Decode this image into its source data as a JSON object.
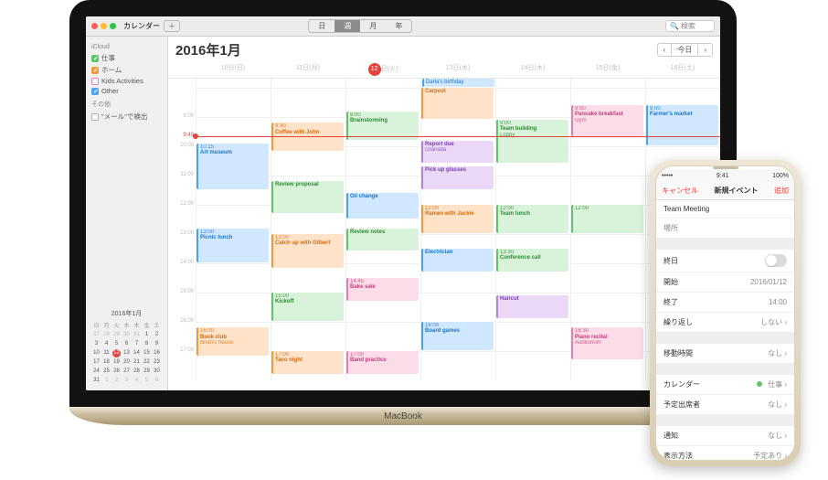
{
  "mac": {
    "titlebar": {
      "app_label": "カレンダー",
      "views": {
        "day": "日",
        "week": "週",
        "month": "月",
        "year": "年"
      },
      "search_placeholder": "検索"
    },
    "sidebar": {
      "sections": {
        "icloud": "iCloud",
        "other": "その他"
      },
      "calendars": [
        {
          "label": "仕事",
          "color": "#60c46a",
          "checked": true
        },
        {
          "label": "ホーム",
          "color": "#f09b3b",
          "checked": true
        },
        {
          "label": "Kids Activities",
          "color": "#e87db0",
          "checked": false
        },
        {
          "label": "Other",
          "color": "#4aa3ef",
          "checked": true
        }
      ],
      "other": [
        {
          "label": "\"メール\"で検出",
          "checked": false
        }
      ],
      "mini": {
        "title": "2016年1月",
        "dow": [
          "日",
          "月",
          "火",
          "水",
          "木",
          "金",
          "土"
        ],
        "weeks": [
          [
            "27",
            "28",
            "29",
            "30",
            "31",
            "1",
            "2"
          ],
          [
            "3",
            "4",
            "5",
            "6",
            "7",
            "8",
            "9"
          ],
          [
            "10",
            "11",
            "12",
            "13",
            "14",
            "15",
            "16"
          ],
          [
            "17",
            "18",
            "19",
            "20",
            "21",
            "22",
            "23"
          ],
          [
            "24",
            "25",
            "26",
            "27",
            "28",
            "29",
            "30"
          ],
          [
            "31",
            "1",
            "2",
            "3",
            "4",
            "5",
            "6"
          ]
        ],
        "today_row": 2,
        "today_col": 2
      }
    },
    "calendar": {
      "title": "2016年1月",
      "today_btn": "今日",
      "days": [
        {
          "label": "10日(日)"
        },
        {
          "label": "11日(月)"
        },
        {
          "label": "12日(火)",
          "today": true
        },
        {
          "label": "13日(水)"
        },
        {
          "label": "14日(木)"
        },
        {
          "label": "15日(金)"
        },
        {
          "label": "16日(土)"
        }
      ],
      "allday": [
        {
          "day": 3,
          "label": "Darla's birthday",
          "color": "blue"
        }
      ],
      "hours": [
        "9:00",
        "10:00",
        "11:00",
        "12:00",
        "13:00",
        "14:00",
        "15:00",
        "16:00",
        "17:00"
      ],
      "now": {
        "day": 2,
        "frac": 0.09
      },
      "events": [
        {
          "day": 0,
          "start": 9.9,
          "end": 11.5,
          "title": "Art museum",
          "time": "10:15",
          "color": "blue"
        },
        {
          "day": 0,
          "start": 12.8,
          "end": 14,
          "title": "Picnic lunch",
          "time": "13:00",
          "color": "blue"
        },
        {
          "day": 0,
          "start": 16.2,
          "end": 17.2,
          "title": "Book club",
          "sub": "Brian's house",
          "time": "16:00",
          "color": "orange"
        },
        {
          "day": 1,
          "start": 9.2,
          "end": 10.2,
          "title": "Coffee with John",
          "time": "9:30",
          "color": "orange"
        },
        {
          "day": 1,
          "start": 11.2,
          "end": 12.3,
          "title": "Review proposal",
          "color": "green"
        },
        {
          "day": 1,
          "start": 13,
          "end": 14.2,
          "title": "Catch up with Gilbert",
          "time": "13:00",
          "color": "orange"
        },
        {
          "day": 1,
          "start": 15,
          "end": 16,
          "title": "Kickoff",
          "time": "15:00",
          "color": "green"
        },
        {
          "day": 1,
          "start": 17,
          "end": 17.8,
          "title": "Taco night",
          "time": "17:00",
          "color": "orange"
        },
        {
          "day": 2,
          "start": 8.8,
          "end": 9.8,
          "title": "Brainstorming",
          "time": "9:00",
          "color": "green"
        },
        {
          "day": 2,
          "start": 11.6,
          "end": 12.5,
          "title": "Oil change",
          "color": "blue"
        },
        {
          "day": 2,
          "start": 12.8,
          "end": 13.6,
          "title": "Review notes",
          "color": "green"
        },
        {
          "day": 2,
          "start": 14.5,
          "end": 15.3,
          "title": "Bake sale",
          "time": "14:45",
          "color": "pink"
        },
        {
          "day": 2,
          "start": 17,
          "end": 17.8,
          "title": "Band practice",
          "time": "17:00",
          "color": "pink"
        },
        {
          "day": 3,
          "start": 8,
          "end": 9.1,
          "title": "Carpool",
          "color": "orange"
        },
        {
          "day": 3,
          "start": 9.8,
          "end": 10.6,
          "title": "Report due",
          "sub": "Granada",
          "color": "purple"
        },
        {
          "day": 3,
          "start": 10.7,
          "end": 11.5,
          "title": "Pick up glasses",
          "color": "purple"
        },
        {
          "day": 3,
          "start": 12,
          "end": 13,
          "title": "Ramen with Jackie",
          "time": "12:00",
          "color": "orange"
        },
        {
          "day": 3,
          "start": 13.5,
          "end": 14.3,
          "title": "Electrician",
          "color": "blue"
        },
        {
          "day": 3,
          "start": 16,
          "end": 17,
          "title": "Board games",
          "time": "16:00",
          "color": "blue"
        },
        {
          "day": 4,
          "start": 9.1,
          "end": 10.6,
          "title": "Team building",
          "sub": "Lobby",
          "time": "9:00",
          "color": "green"
        },
        {
          "day": 4,
          "start": 12,
          "end": 13,
          "title": "Team lunch",
          "time": "12:00",
          "color": "green"
        },
        {
          "day": 4,
          "start": 13.5,
          "end": 14.3,
          "title": "Conference call",
          "time": "13:30",
          "color": "green"
        },
        {
          "day": 4,
          "start": 15.1,
          "end": 15.9,
          "title": "Haircut",
          "color": "purple"
        },
        {
          "day": 5,
          "start": 8.6,
          "end": 9.7,
          "title": "Pancake breakfast",
          "sub": "Gym",
          "time": "9:00",
          "color": "pink"
        },
        {
          "day": 5,
          "start": 12,
          "end": 13,
          "title": "",
          "time": "12:00",
          "color": "green"
        },
        {
          "day": 5,
          "start": 16.2,
          "end": 17.3,
          "title": "Piano recital",
          "sub": "Auditorium",
          "time": "16:30",
          "color": "pink"
        },
        {
          "day": 6,
          "start": 8.6,
          "end": 10,
          "title": "Farmer's market",
          "time": "9:00",
          "color": "blue"
        }
      ]
    },
    "hinge_label": "MacBook"
  },
  "iphone": {
    "status": {
      "carrier": "•••••",
      "time": "9:41",
      "batt": "100%"
    },
    "nav": {
      "cancel": "キャンセル",
      "title": "新規イベント",
      "add": "追加"
    },
    "event_title": "Team Meeting",
    "location_ph": "場所",
    "rows": {
      "allday_label": "終日",
      "start_label": "開始",
      "start_value": "2016/01/12",
      "end_label": "終了",
      "end_value": "14:00",
      "repeat_label": "繰り返し",
      "repeat_value": "しない",
      "travel_label": "移動時間",
      "travel_value": "なし",
      "cal_label": "カレンダー",
      "cal_value": "仕事",
      "cal_color": "#60c46a",
      "invitees_label": "予定出席者",
      "invitees_value": "なし",
      "alert_label": "通知",
      "alert_value": "なし",
      "showas_label": "表示方法",
      "showas_value": "予定あり"
    }
  }
}
